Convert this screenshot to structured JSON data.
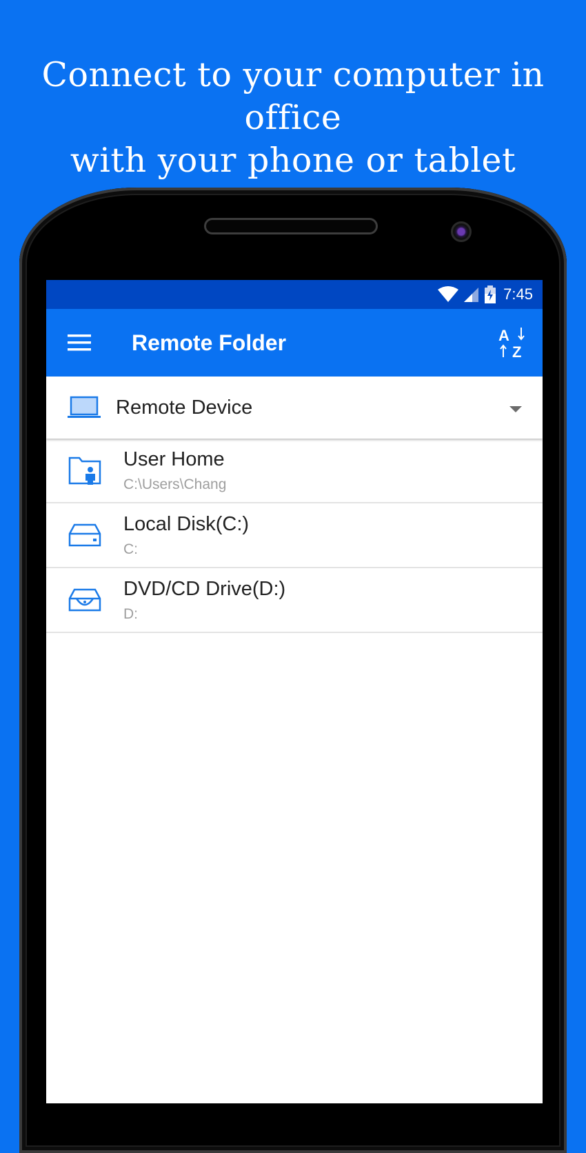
{
  "promo": {
    "line1": "Connect to your computer in office",
    "line2": "with your phone or tablet"
  },
  "status_bar": {
    "time": "7:45",
    "icons": [
      "wifi-icon",
      "cell-signal-icon",
      "battery-charging-icon"
    ]
  },
  "app_bar": {
    "title": "Remote Folder",
    "menu_icon": "hamburger-menu-icon",
    "sort_icon": "sort-az-icon"
  },
  "device_selector": {
    "label": "Remote Device",
    "icon": "laptop-icon"
  },
  "items": [
    {
      "title": "User Home",
      "subtitle": "C:\\Users\\Chang",
      "icon": "user-folder-icon"
    },
    {
      "title": "Local Disk(C:)",
      "subtitle": "C:",
      "icon": "hard-disk-icon"
    },
    {
      "title": "DVD/CD Drive(D:)",
      "subtitle": "D:",
      "icon": "dvd-drive-icon"
    }
  ],
  "colors": {
    "background": "#0a72f2",
    "status_bar": "#0047c2",
    "app_bar": "#0a72f2",
    "icon_blue": "#1a7ae8"
  }
}
